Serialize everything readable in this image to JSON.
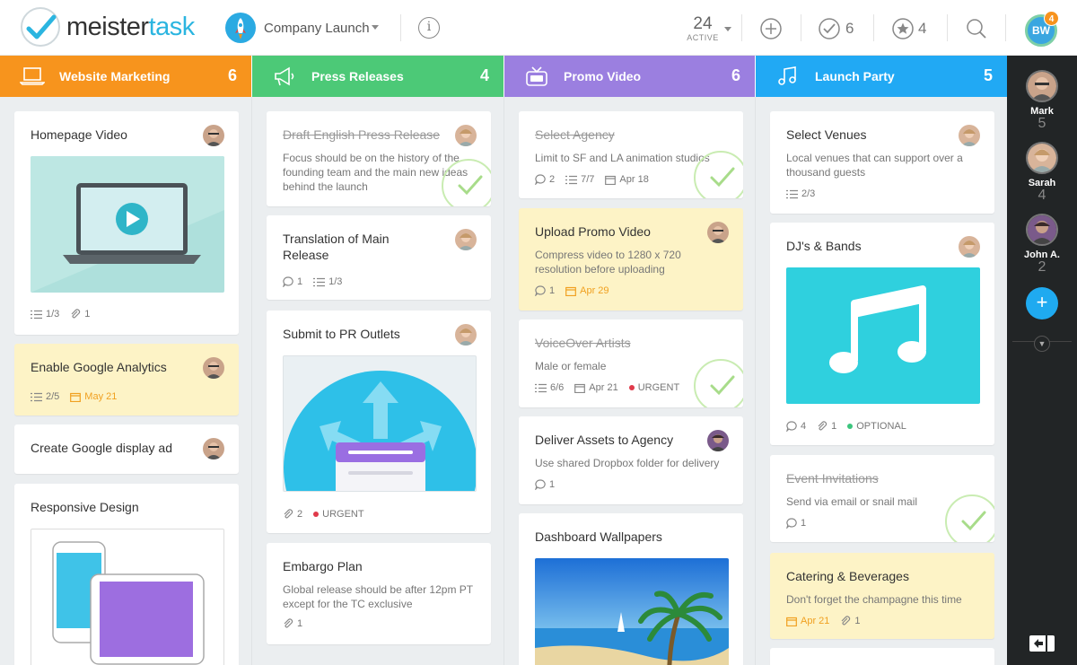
{
  "app": {
    "logo_part1": "meister",
    "logo_part2": "task",
    "project_name": "Company Launch"
  },
  "header": {
    "active_count": "24",
    "active_label": "ACTIVE",
    "checked_count": "6",
    "starred_count": "4",
    "user_initials": "BW",
    "notification_count": "4"
  },
  "columns": [
    {
      "name": "Website Marketing",
      "count": "6",
      "color": "#f7941d",
      "cards": [
        {
          "title": "Homepage Video",
          "checklist": "1/3",
          "attachments": "1"
        },
        {
          "title": "Enable Google Analytics",
          "checklist": "2/5",
          "due": "May 21"
        },
        {
          "title": "Create Google display ad"
        },
        {
          "title": "Responsive Design"
        }
      ]
    },
    {
      "name": "Press Releases",
      "count": "4",
      "color": "#4cc977",
      "cards": [
        {
          "title": "Draft English Press Release",
          "desc": "Focus should be on the history of the founding team and the main new ideas behind the launch"
        },
        {
          "title": "Translation of Main Release",
          "comments": "1",
          "checklist": "1/3"
        },
        {
          "title": "Submit to PR Outlets",
          "attachments": "2",
          "tag": "URGENT"
        },
        {
          "title": "Embargo Plan",
          "desc": "Global release should be after 12pm PT except for the TC exclusive",
          "attachments": "1"
        }
      ]
    },
    {
      "name": "Promo Video",
      "count": "6",
      "color": "#9b7fe0",
      "cards": [
        {
          "title": "Select Agency",
          "desc": "Limit to SF and LA animation studios",
          "comments": "2",
          "checklist": "7/7",
          "due": "Apr 18"
        },
        {
          "title": "Upload Promo Video",
          "desc": "Compress video to 1280 x 720 resolution before uploading",
          "comments": "1",
          "due": "Apr 29"
        },
        {
          "title": "VoiceOver Artists",
          "desc": "Male or female",
          "checklist": "6/6",
          "due": "Apr 21",
          "tag": "URGENT"
        },
        {
          "title": "Deliver Assets to Agency",
          "desc": "Use shared Dropbox folder for delivery",
          "comments": "1"
        },
        {
          "title": "Dashboard Wallpapers"
        }
      ]
    },
    {
      "name": "Launch Party",
      "count": "5",
      "color": "#21a9f4",
      "cards": [
        {
          "title": "Select Venues",
          "desc": "Local venues that can support over a thousand guests",
          "checklist": "2/3"
        },
        {
          "title": "DJ's & Bands",
          "comments": "4",
          "attachments": "1",
          "tag": "OPTIONAL"
        },
        {
          "title": "Event Invitations",
          "desc": "Send via email or snail mail",
          "comments": "1"
        },
        {
          "title": "Catering & Beverages",
          "desc": "Don't forget the champagne this time",
          "due": "Apr 21",
          "attachments": "1"
        }
      ]
    }
  ],
  "sidebar": {
    "users": [
      {
        "name": "Mark",
        "count": "5"
      },
      {
        "name": "Sarah",
        "count": "4"
      },
      {
        "name": "John A.",
        "count": "2"
      }
    ],
    "add_label": "+"
  },
  "icons": [
    "logo-check-icon",
    "rocket-icon",
    "chevron-down-icon",
    "info-icon",
    "plus-circle-icon",
    "check-circle-icon",
    "star-circle-icon",
    "search-icon",
    "laptop-icon",
    "megaphone-icon",
    "tv-icon",
    "music-note-icon",
    "checklist-icon",
    "paperclip-icon",
    "comment-icon",
    "calendar-icon",
    "collapse-sidebar-icon"
  ]
}
